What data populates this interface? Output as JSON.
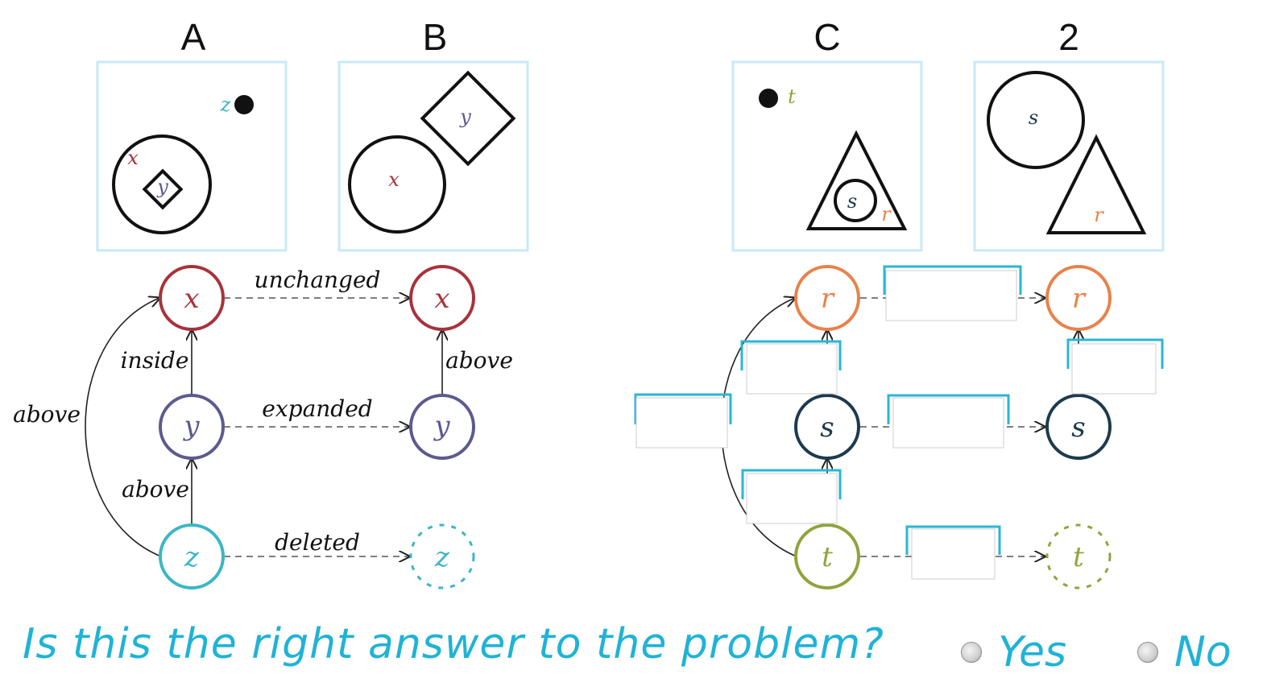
{
  "panels": {
    "a": {
      "title": "A",
      "labels": {
        "z": "z",
        "x": "x",
        "y": "y"
      }
    },
    "b": {
      "title": "B",
      "labels": {
        "x": "x",
        "y": "y"
      }
    },
    "c": {
      "title": "C",
      "labels": {
        "t": "t",
        "s": "s",
        "r": "r"
      }
    },
    "d": {
      "title": "2",
      "labels": {
        "s": "s",
        "r": "r"
      }
    }
  },
  "left_graph": {
    "nodes": {
      "x": "x",
      "y": "y",
      "z": "z",
      "x2": "x",
      "y2": "y",
      "z2": "z"
    },
    "edges": {
      "unchanged": "unchanged",
      "inside": "inside",
      "above_right": "above",
      "above_arc": "above",
      "expanded": "expanded",
      "above_lower": "above",
      "deleted": "deleted"
    }
  },
  "right_graph": {
    "nodes": {
      "r": "r",
      "s": "s",
      "t": "t",
      "r2": "r",
      "s2": "s",
      "t2": "t"
    }
  },
  "colors": {
    "x": "#a8323a",
    "y": "#5c5a8e",
    "z": "#3bb6c6",
    "r": "#e8824a",
    "s": "#1d3a4f",
    "t": "#8fa43c",
    "accent": "#29b6d6",
    "panel_border": "#c9eaf5"
  },
  "question": {
    "text": "Is this the right answer to the problem?",
    "options": {
      "yes": "Yes",
      "no": "No"
    }
  }
}
